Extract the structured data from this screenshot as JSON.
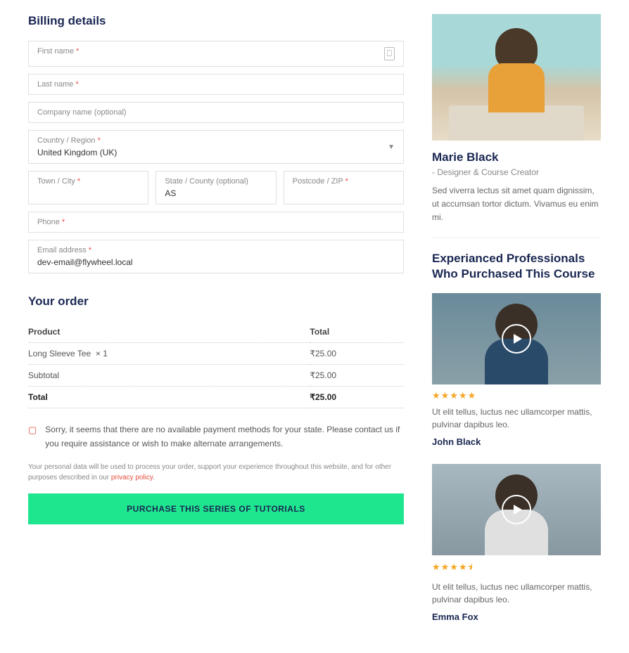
{
  "billing": {
    "title": "Billing details",
    "first_name_label": "First name",
    "last_name_label": "Last name",
    "company_label": "Company name (optional)",
    "country_label": "Country / Region",
    "country_value": "United Kingdom (UK)",
    "town_label": "Town / City",
    "state_label": "State / County (optional)",
    "state_value": "AS",
    "postcode_label": "Postcode / ZIP",
    "phone_label": "Phone",
    "email_label": "Email address",
    "email_value": "dev-email@flywheel.local",
    "required_marker": "*"
  },
  "order": {
    "title": "Your order",
    "product_header": "Product",
    "total_header": "Total",
    "product_name": "Long Sleeve Tee",
    "product_qty": "× 1",
    "product_price": "₹25.00",
    "subtotal_label": "Subtotal",
    "subtotal_value": "₹25.00",
    "total_label": "Total",
    "total_value": "₹25.00"
  },
  "payment": {
    "notice": "Sorry, it seems that there are no available payment methods for your state. Please contact us if you require assistance or wish to make alternate arrangements.",
    "privacy_pre": "Your personal data will be used to process your order, support your experience throughout this website, and for other purposes described in our ",
    "privacy_link": "privacy policy",
    "button": "PURCHASE THIS SERIES OF TUTORIALS"
  },
  "author": {
    "name": "Marie Black",
    "role": "- Designer & Course Creator",
    "bio": "Sed viverra lectus sit amet quam dignissim, ut accumsan tortor dictum. Vivamus eu enim mi."
  },
  "testimonials": {
    "title": "Experianced Professionals Who Purchased This Course",
    "items": [
      {
        "stars": "★★★★★",
        "text": "Ut elit tellus, luctus nec ullamcorper mattis, pulvinar dapibus leo.",
        "name": "John Black"
      },
      {
        "stars": "★★★★⯨",
        "text": "Ut elit tellus, luctus nec ullamcorper mattis, pulvinar dapibus leo.",
        "name": "Emma Fox"
      }
    ]
  }
}
